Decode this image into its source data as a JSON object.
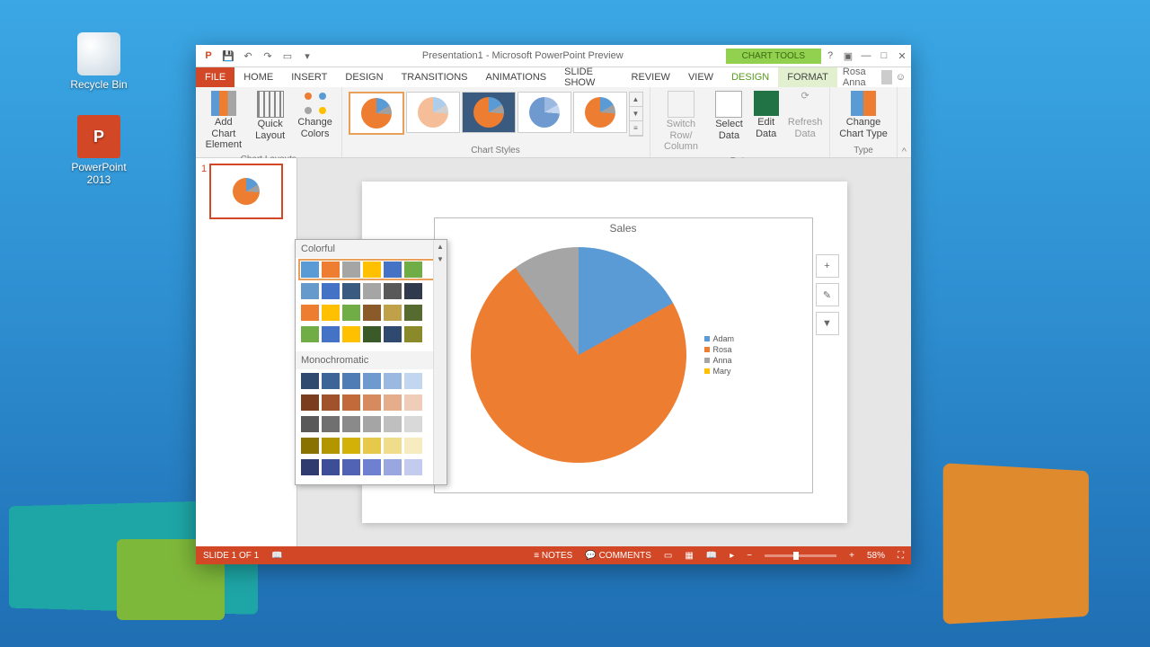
{
  "desktop": {
    "recycle": "Recycle Bin",
    "ppt": "PowerPoint 2013"
  },
  "titlebar": {
    "title": "Presentation1 - Microsoft PowerPoint Preview",
    "chart_tools": "CHART TOOLS"
  },
  "tabs": {
    "file": "FILE",
    "home": "HOME",
    "insert": "INSERT",
    "design": "DESIGN",
    "transitions": "TRANSITIONS",
    "animations": "ANIMATIONS",
    "slideshow": "SLIDE SHOW",
    "review": "REVIEW",
    "view": "VIEW",
    "ctx_design": "DESIGN",
    "ctx_format": "FORMAT"
  },
  "user": "Rosa Anna",
  "ribbon": {
    "add_chart_element": "Add Chart Element",
    "quick_layout": "Quick Layout",
    "change_colors": "Change Colors",
    "chart_layouts": "Chart Layouts",
    "chart_styles": "Chart Styles",
    "switch_row": "Switch Row/ Column",
    "select_data": "Select Data",
    "edit_data": "Edit Data",
    "refresh_data": "Refresh Data",
    "data": "Data",
    "change_chart_type": "Change Chart Type",
    "type": "Type"
  },
  "color_dd": {
    "colorful": "Colorful",
    "monochromatic": "Monochromatic",
    "colorful_rows": [
      [
        "#5b9bd5",
        "#ed7d31",
        "#a5a5a5",
        "#ffc000",
        "#4472c4",
        "#70ad47"
      ],
      [
        "#6699cc",
        "#4472c4",
        "#3b5a80",
        "#a5a5a5",
        "#595959",
        "#2f3b4c"
      ],
      [
        "#ed7d31",
        "#ffc000",
        "#70ad47",
        "#8b5a2b",
        "#bfa14a",
        "#556b2f"
      ],
      [
        "#70ad47",
        "#4472c4",
        "#ffc000",
        "#3b5a2a",
        "#2f4a6e",
        "#8a8a2a"
      ]
    ],
    "mono_rows": [
      [
        "#2f4a6e",
        "#3d6496",
        "#4f7cb5",
        "#6f9ad0",
        "#9ab8e0",
        "#c3d6ef"
      ],
      [
        "#7a3e1e",
        "#a0522d",
        "#c26a3a",
        "#d68a5e",
        "#e5ad8c",
        "#f0cdb8"
      ],
      [
        "#595959",
        "#707070",
        "#8a8a8a",
        "#a5a5a5",
        "#bfbfbf",
        "#d9d9d9"
      ],
      [
        "#8a7200",
        "#b39500",
        "#d4b106",
        "#e6c84a",
        "#f0dd8c",
        "#f7ecc0"
      ],
      [
        "#2f3b6e",
        "#3d4d96",
        "#5163b5",
        "#7080d0",
        "#9aa6e0",
        "#c3cbef"
      ]
    ]
  },
  "status": {
    "slide": "SLIDE 1 OF 1",
    "notes": "NOTES",
    "comments": "COMMENTS",
    "zoom": "58%"
  },
  "chart_data": {
    "type": "pie",
    "title": "Sales",
    "series": [
      {
        "name": "Adam",
        "value": 17,
        "color": "#5b9bd5"
      },
      {
        "name": "Rosa",
        "value": 73,
        "color": "#ed7d31"
      },
      {
        "name": "Anna",
        "value": 10,
        "color": "#a5a5a5"
      },
      {
        "name": "Mary",
        "value": 0,
        "color": "#ffc000"
      }
    ]
  }
}
